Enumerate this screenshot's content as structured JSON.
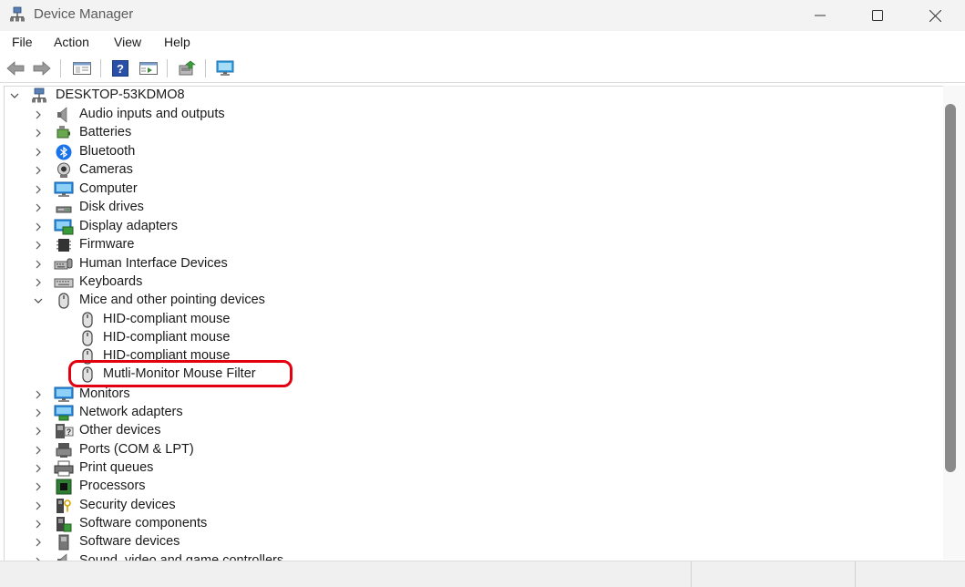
{
  "window": {
    "title": "Device Manager"
  },
  "menu": [
    "File",
    "Action",
    "View",
    "Help"
  ],
  "tree": {
    "root": "DESKTOP-53KDMO8",
    "items": [
      {
        "label": "Audio inputs and outputs",
        "icon": "speaker-icon",
        "expanded": false
      },
      {
        "label": "Batteries",
        "icon": "battery-icon",
        "expanded": false
      },
      {
        "label": "Bluetooth",
        "icon": "bluetooth-icon",
        "expanded": false
      },
      {
        "label": "Cameras",
        "icon": "camera-icon",
        "expanded": false
      },
      {
        "label": "Computer",
        "icon": "computer-icon",
        "expanded": false
      },
      {
        "label": "Disk drives",
        "icon": "disk-drive-icon",
        "expanded": false
      },
      {
        "label": "Display adapters",
        "icon": "display-adapter-icon",
        "expanded": false
      },
      {
        "label": "Firmware",
        "icon": "firmware-icon",
        "expanded": false
      },
      {
        "label": "Human Interface Devices",
        "icon": "hid-icon",
        "expanded": false
      },
      {
        "label": "Keyboards",
        "icon": "keyboard-icon",
        "expanded": false
      },
      {
        "label": "Mice and other pointing devices",
        "icon": "mouse-icon",
        "expanded": true,
        "children": [
          "HID-compliant mouse",
          "HID-compliant mouse",
          "HID-compliant mouse",
          "Mutli-Monitor Mouse Filter"
        ]
      },
      {
        "label": "Monitors",
        "icon": "monitor-icon",
        "expanded": false
      },
      {
        "label": "Network adapters",
        "icon": "network-adapter-icon",
        "expanded": false
      },
      {
        "label": "Other devices",
        "icon": "other-devices-icon",
        "expanded": false
      },
      {
        "label": "Ports (COM & LPT)",
        "icon": "port-icon",
        "expanded": false
      },
      {
        "label": "Print queues",
        "icon": "printer-icon",
        "expanded": false
      },
      {
        "label": "Processors",
        "icon": "processor-icon",
        "expanded": false
      },
      {
        "label": "Security devices",
        "icon": "security-device-icon",
        "expanded": false
      },
      {
        "label": "Software components",
        "icon": "software-component-icon",
        "expanded": false
      },
      {
        "label": "Software devices",
        "icon": "software-device-icon",
        "expanded": false
      },
      {
        "label": "Sound, video and game controllers",
        "icon": "sound-controller-icon",
        "expanded": false
      }
    ]
  },
  "highlighted_item": "Mutli-Monitor Mouse Filter",
  "colors": {
    "highlight": "#e3000f",
    "scroll_thumb": "#8a8a8a"
  }
}
